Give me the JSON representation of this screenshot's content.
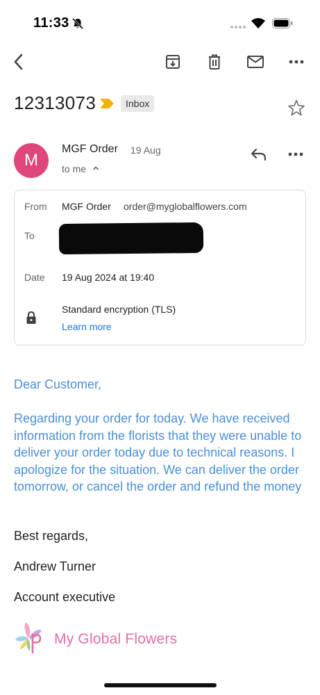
{
  "status_bar": {
    "time": "11:33"
  },
  "toolbar": {
    "back_icon": "chevron-left-icon",
    "archive_icon": "archive-icon",
    "delete_icon": "trash-icon",
    "mark_unread_icon": "mail-icon",
    "more_icon": "more-horizontal-icon"
  },
  "subject": {
    "title": "12313073",
    "label": "Inbox",
    "important_color": "#f2b400"
  },
  "sender": {
    "avatar_letter": "M",
    "avatar_color": "#e0457b",
    "name": "MGF Order",
    "date": "19 Aug",
    "to": "to me"
  },
  "details": {
    "from_label": "From",
    "from_name": "MGF Order",
    "from_email": "order@myglobalflowers.com",
    "to_label": "To",
    "date_label": "Date",
    "date_value": "19 Aug 2024 at 19:40",
    "encryption": "Standard encryption (TLS)",
    "learn_more": "Learn more"
  },
  "message": {
    "greeting": "Dear Customer,",
    "paragraph": "Regarding your order for today. We have received information from the florists that they were unable to deliver your order today due to technical reasons. I apologize for the situation. We can deliver the order tomorrow, or cancel the order and refund the money",
    "closing": "Best regards,",
    "signature_name": "Andrew Turner",
    "signature_title": "Account executive"
  },
  "logo": {
    "text": "My Global Flowers"
  },
  "colors": {
    "link": "#1a73e8",
    "body_blue": "#4a8fd6",
    "accent_pink": "#e36fa6"
  }
}
